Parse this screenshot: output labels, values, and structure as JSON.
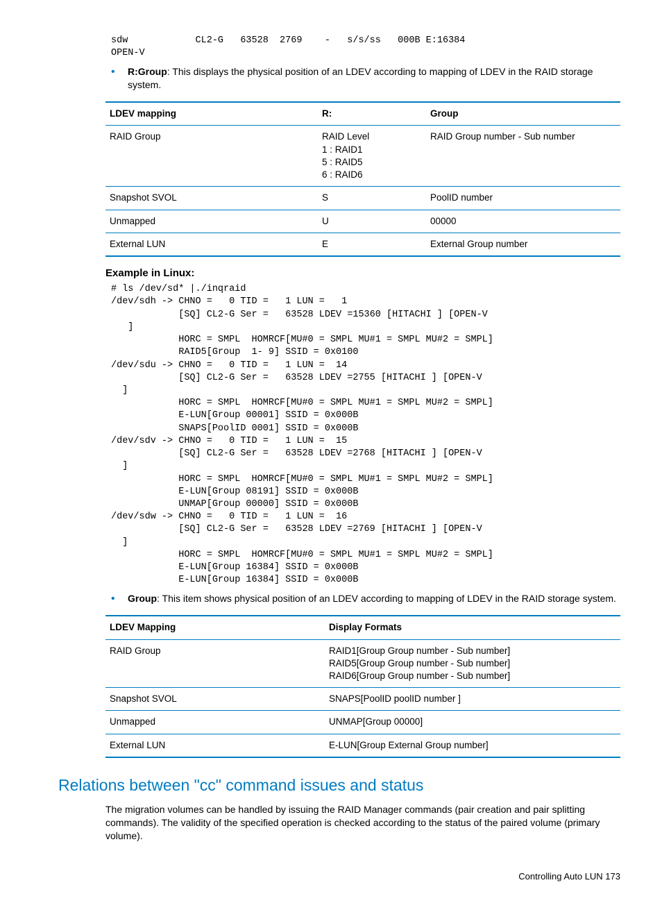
{
  "code_top": "sdw            CL2-G   63528  2769    -   s/s/ss   000B E:16384\nOPEN-V",
  "bullet1_lead": "R:Group",
  "bullet1_rest": ": This displays the physical position of an LDEV according to mapping of LDEV in the RAID storage system.",
  "table1": {
    "headers": [
      "LDEV mapping",
      "R:",
      "Group"
    ],
    "rows": [
      [
        "RAID Group",
        "RAID Level\n1 : RAID1\n5 : RAID5\n6 : RAID6",
        "RAID Group number - Sub number"
      ],
      [
        "Snapshot SVOL",
        "S",
        "PoolID number"
      ],
      [
        "Unmapped",
        "U",
        "00000"
      ],
      [
        "External LUN",
        "E",
        "External Group number"
      ]
    ]
  },
  "example_heading": "Example in Linux:",
  "example_code": "# ls /dev/sd* |./inqraid\n/dev/sdh -> CHNO =   0 TID =   1 LUN =   1\n            [SQ] CL2-G Ser =   63528 LDEV =15360 [HITACHI ] [OPEN-V\n   ]\n            HORC = SMPL  HOMRCF[MU#0 = SMPL MU#1 = SMPL MU#2 = SMPL]\n            RAID5[Group  1- 9] SSID = 0x0100\n/dev/sdu -> CHNO =   0 TID =   1 LUN =  14\n            [SQ] CL2-G Ser =   63528 LDEV =2755 [HITACHI ] [OPEN-V\n  ]\n            HORC = SMPL  HOMRCF[MU#0 = SMPL MU#1 = SMPL MU#2 = SMPL]\n            E-LUN[Group 00001] SSID = 0x000B\n            SNAPS[PoolID 0001] SSID = 0x000B\n/dev/sdv -> CHNO =   0 TID =   1 LUN =  15\n            [SQ] CL2-G Ser =   63528 LDEV =2768 [HITACHI ] [OPEN-V\n  ]\n            HORC = SMPL  HOMRCF[MU#0 = SMPL MU#1 = SMPL MU#2 = SMPL]\n            E-LUN[Group 08191] SSID = 0x000B\n            UNMAP[Group 00000] SSID = 0x000B\n/dev/sdw -> CHNO =   0 TID =   1 LUN =  16\n            [SQ] CL2-G Ser =   63528 LDEV =2769 [HITACHI ] [OPEN-V\n  ]\n            HORC = SMPL  HOMRCF[MU#0 = SMPL MU#1 = SMPL MU#2 = SMPL]\n            E-LUN[Group 16384] SSID = 0x000B\n            E-LUN[Group 16384] SSID = 0x000B",
  "bullet2_lead": "Group",
  "bullet2_rest": ": This item shows physical position of an LDEV according to mapping of LDEV in the RAID storage system.",
  "table2": {
    "headers": [
      "LDEV Mapping",
      "Display Formats"
    ],
    "rows": [
      [
        "RAID Group",
        "RAID1[Group Group number - Sub number]\nRAID5[Group Group number - Sub number]\nRAID6[Group Group number - Sub number]"
      ],
      [
        "Snapshot SVOL",
        "SNAPS[PoolID poolID number ]"
      ],
      [
        "Unmapped",
        "UNMAP[Group 00000]"
      ],
      [
        "External LUN",
        "E-LUN[Group External Group number]"
      ]
    ]
  },
  "section_heading": "Relations between \"cc\" command issues and status",
  "section_para": "The migration volumes can be handled by issuing the RAID Manager commands (pair creation and pair splitting commands). The validity of the specified operation is checked according to the status of the paired volume (primary volume).",
  "footer": "Controlling Auto LUN   173"
}
